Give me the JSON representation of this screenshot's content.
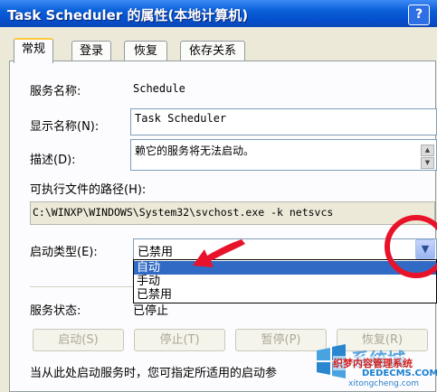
{
  "window": {
    "title": "Task Scheduler 的属性(本地计算机)",
    "help_label": "?"
  },
  "tabs": [
    {
      "label": "常规",
      "active": true
    },
    {
      "label": "登录",
      "active": false
    },
    {
      "label": "恢复",
      "active": false
    },
    {
      "label": "依存关系",
      "active": false
    }
  ],
  "general": {
    "service_name_label": "服务名称:",
    "service_name_value": "Schedule",
    "display_name_label": "显示名称(N):",
    "display_name_value": "Task Scheduler",
    "description_label": "描述(D):",
    "description_value": "赖它的服务将无法启动。",
    "exec_path_label": "可执行文件的路径(H):",
    "exec_path_value": "C:\\WINXP\\WINDOWS\\System32\\svchost.exe -k netsvcs",
    "startup_type_label": "启动类型(E):",
    "startup_type_value": "已禁用",
    "startup_type_options": [
      "自动",
      "手动",
      "已禁用"
    ],
    "highlighted_option": "自动",
    "service_status_label": "服务状态:",
    "service_status_value": "已停止",
    "bottom_text": "当从此处启动服务时，您可指定所适用的启动参"
  },
  "buttons": {
    "start": "启动(S)",
    "stop": "停止(T)",
    "pause": "暂停(P)",
    "resume": "恢复(R)"
  },
  "watermark": {
    "brand": "系统城",
    "line1": "织梦内容管理系统",
    "line2": "DEDECMS.COM",
    "line3": "xitongcheng.com"
  },
  "colors": {
    "titlebar": "#0a5fd8",
    "annotation": "#e8132a",
    "selection": "#316ac5"
  }
}
